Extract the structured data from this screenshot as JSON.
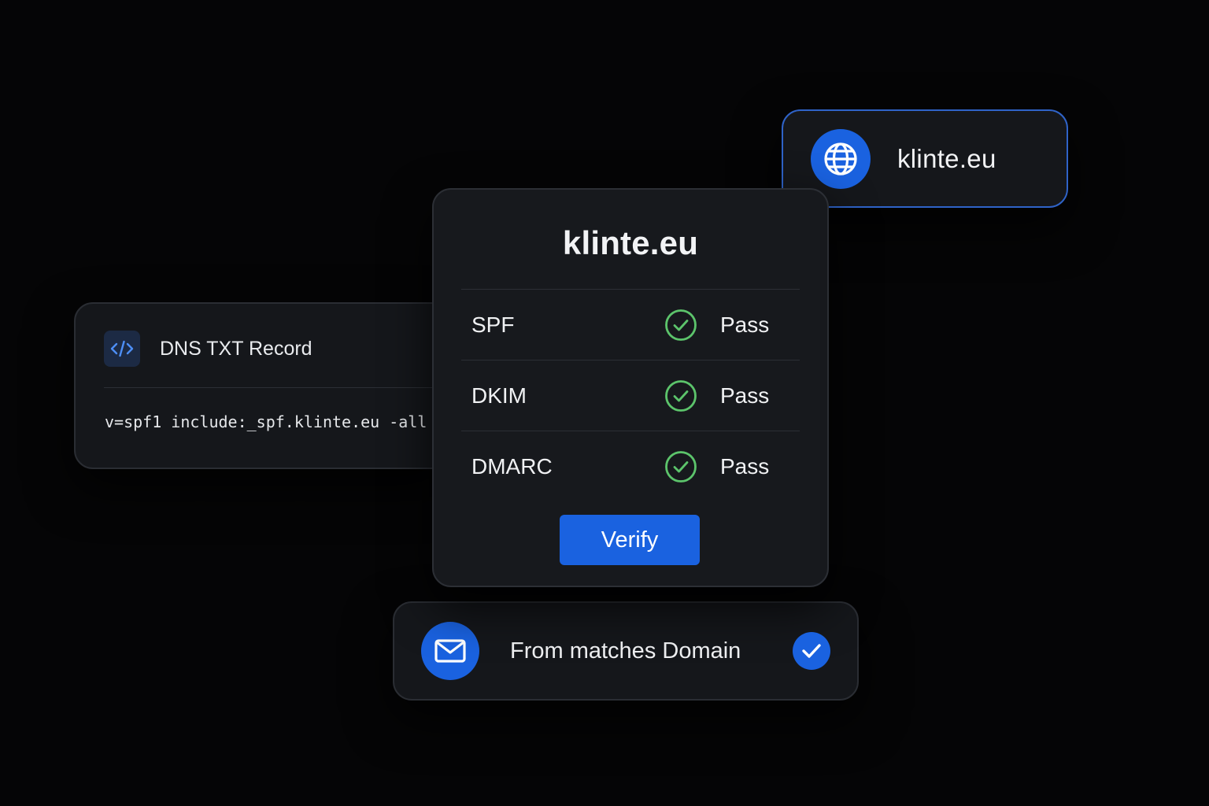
{
  "domain_chip": {
    "label": "klinte.eu",
    "icon": "globe-icon"
  },
  "dns_card": {
    "title": "DNS TXT Record",
    "icon": "code-icon",
    "record": "v=spf1 include:_spf.klinte.eu -all"
  },
  "verification": {
    "title": "klinte.eu",
    "checks": [
      {
        "name": "SPF",
        "status": "Pass",
        "icon": "check-circle-icon"
      },
      {
        "name": "DKIM",
        "status": "Pass",
        "icon": "check-circle-icon"
      },
      {
        "name": "DMARC",
        "status": "Pass",
        "icon": "check-circle-icon"
      }
    ],
    "verify_label": "Verify"
  },
  "from_card": {
    "label": "From matches Domain",
    "icon": "mail-icon",
    "check_icon": "checkmark-icon"
  },
  "colors": {
    "accent": "#1a62e0",
    "pass_green": "#5cc46b",
    "background": "#050506",
    "card": "#15171b"
  }
}
